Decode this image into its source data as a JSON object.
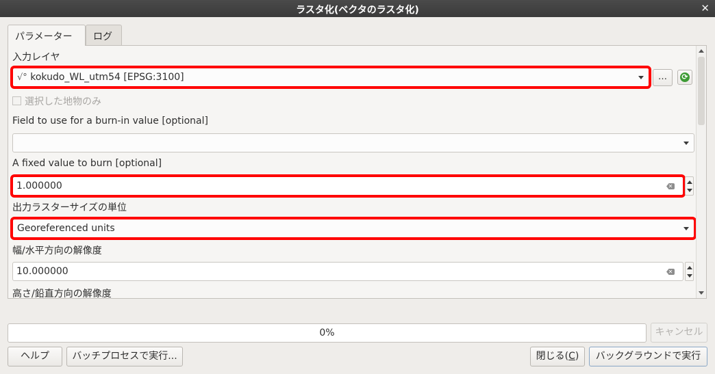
{
  "window": {
    "title": "ラスタ化(ベクタのラスタ化)"
  },
  "tabs": [
    {
      "label": "パラメーター",
      "active": true
    },
    {
      "label": "ログ",
      "active": false
    }
  ],
  "params": {
    "input_layer": {
      "label": "入力レイヤ",
      "value": "kokudo_WL_utm54 [EPSG:3100]",
      "layer_icon": "√°",
      "browse_label": "…"
    },
    "selected_only": {
      "label": "選択した地物のみ",
      "checked": false
    },
    "burn_field": {
      "label": "Field to use for a burn-in value [optional]",
      "value": ""
    },
    "fixed_value": {
      "label": "A fixed value to burn [optional]",
      "value": "1.000000"
    },
    "size_units": {
      "label": "出力ラスターサイズの単位",
      "value": "Georeferenced units"
    },
    "width_res": {
      "label": "幅/水平方向の解像度",
      "value": "10.000000"
    },
    "height_res": {
      "label": "高さ/鉛直方向の解像度"
    }
  },
  "progress": {
    "value": 0,
    "text": "0%"
  },
  "buttons": {
    "cancel": "キャンセル",
    "help": "ヘルプ",
    "batch": "バッチプロセスで実行...",
    "close_main": "閉じる(",
    "close_key": "C",
    "close_end": ")",
    "run_background": "バックグラウンドで実行"
  },
  "colors": {
    "highlight": "#ff0000",
    "titlebar": "#3a3a3a",
    "progress_fill": "#7ca7d6"
  }
}
